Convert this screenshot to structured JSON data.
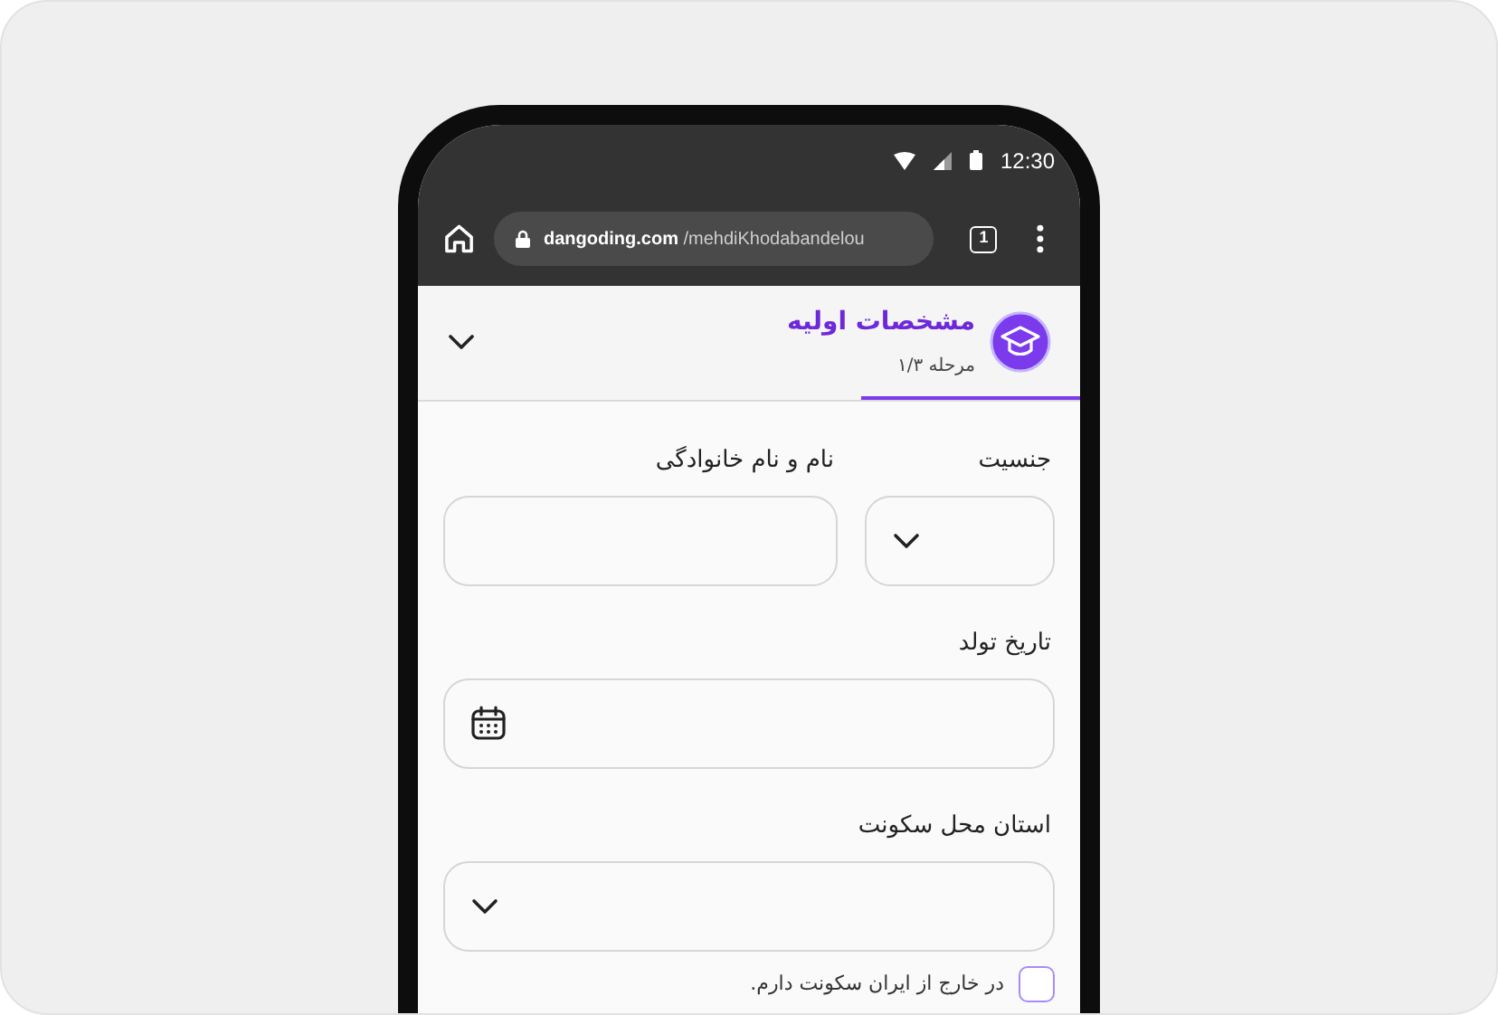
{
  "status_bar": {
    "time": "12:30"
  },
  "browser": {
    "url_domain": "dangoding.com",
    "url_path": "/mehdiKhodabandelou",
    "tab_count": "1"
  },
  "step_header": {
    "title": "مشخصات اولیه",
    "step": "مرحله ۱/۳",
    "progress": {
      "level": 0.33
    }
  },
  "form": {
    "rows": [
      {
        "fields": [
          {
            "kind": "select",
            "label": "جنسیت"
          },
          {
            "kind": "text",
            "label": "نام و نام خانوادگی"
          }
        ]
      },
      {
        "fields": [
          {
            "kind": "date",
            "label": "تاریخ تولد"
          }
        ]
      },
      {
        "fields": [
          {
            "kind": "select",
            "label": "استان محل سکونت"
          }
        ]
      }
    ],
    "checkbox": {
      "label": "در خارج از ایران سکونت دارم.",
      "checked": false
    }
  }
}
